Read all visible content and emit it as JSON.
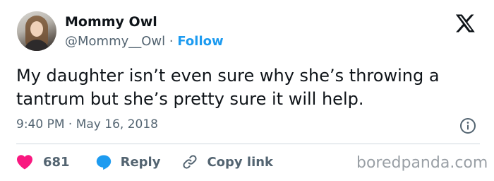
{
  "author": {
    "display_name": "Mommy Owl",
    "handle": "@Mommy__Owl",
    "separator": "·",
    "follow_label": "Follow",
    "avatar_icon": "user-avatar"
  },
  "brand": {
    "logo_icon": "x-logo-icon"
  },
  "tweet": {
    "text": "My daughter isn’t even sure why she’s throwing a tantrum but she’s pretty sure it will help.",
    "timestamp": "9:40 PM · May 16, 2018"
  },
  "actions": {
    "like_count": "681",
    "reply_label": "Reply",
    "copy_link_label": "Copy link"
  },
  "colors": {
    "text": "#0f1419",
    "secondary": "#536471",
    "accent": "#1d9bf0",
    "like": "#f91880",
    "divider": "#cfd9de"
  },
  "watermark": "boredpanda.com"
}
